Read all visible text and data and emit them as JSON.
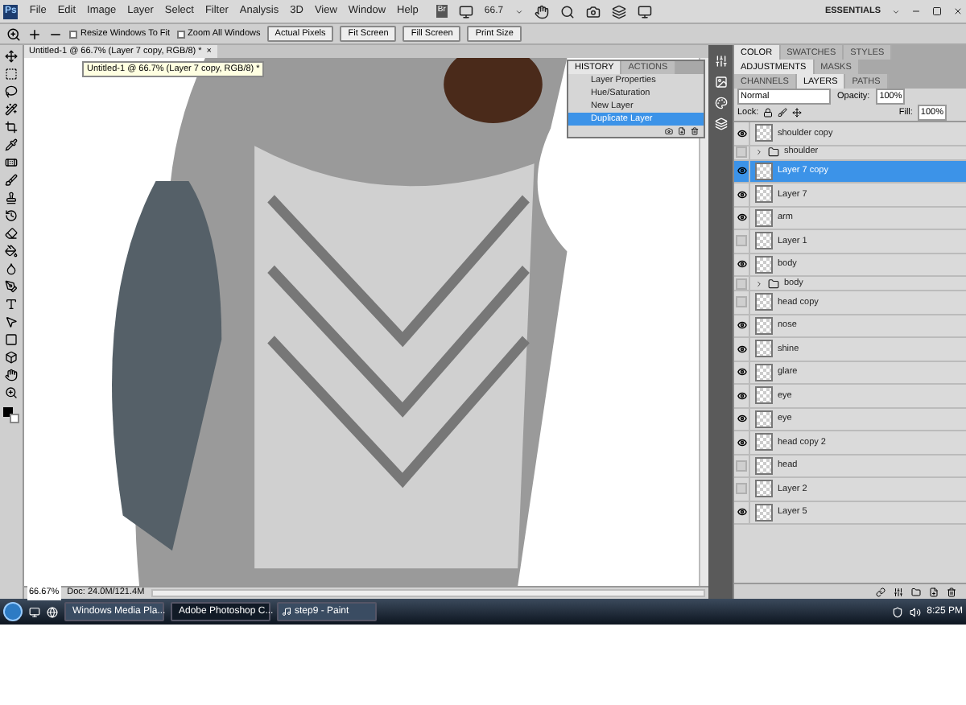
{
  "app_bar": {
    "logo": "Ps",
    "menus": [
      "File",
      "Edit",
      "Image",
      "Layer",
      "Select",
      "Filter",
      "Analysis",
      "3D",
      "View",
      "Window",
      "Help"
    ],
    "bridge": "Br",
    "zoom": "66.7",
    "workspace": "ESSENTIALS"
  },
  "options_bar": {
    "checkboxes": [
      {
        "label": "Resize Windows To Fit",
        "checked": false
      },
      {
        "label": "Zoom All Windows",
        "checked": false
      }
    ],
    "buttons": [
      "Actual Pixels",
      "Fit Screen",
      "Fill Screen",
      "Print Size"
    ]
  },
  "document": {
    "tab": "Untitled-1 @ 66.7% (Layer 7 copy, RGB/8) *",
    "close": "×",
    "tooltip": "Untitled-1 @ 66.7% (Layer 7 copy, RGB/8) *",
    "zoom": "66.67%",
    "doc_size": "Doc: 24.0M/121.4M"
  },
  "history": {
    "tabs": [
      {
        "label": "HISTORY",
        "selected": true
      },
      {
        "label": "ACTIONS",
        "selected": false
      }
    ],
    "items": [
      {
        "label": "Layer Properties",
        "selected": false
      },
      {
        "label": "Hue/Saturation",
        "selected": false
      },
      {
        "label": "New Layer",
        "selected": false
      },
      {
        "label": "Duplicate Layer",
        "selected": true
      }
    ]
  },
  "panel_groups": [
    [
      {
        "label": "COLOR",
        "selected": true
      },
      {
        "label": "SWATCHES",
        "selected": false
      },
      {
        "label": "STYLES",
        "selected": false
      }
    ],
    [
      {
        "label": "ADJUSTMENTS",
        "selected": true
      },
      {
        "label": "MASKS",
        "selected": false
      }
    ],
    [
      {
        "label": "CHANNELS",
        "selected": false
      },
      {
        "label": "LAYERS",
        "selected": true
      },
      {
        "label": "PATHS",
        "selected": false
      }
    ]
  ],
  "layers_panel": {
    "blend_mode": "Normal",
    "opacity_label": "Opacity:",
    "opacity": "100%",
    "lock_label": "Lock:",
    "fill_label": "Fill:",
    "fill": "100%",
    "layers": [
      {
        "kind": "layer",
        "name": "shoulder copy",
        "visible": true,
        "selected": false
      },
      {
        "kind": "group",
        "name": "shoulder",
        "visible": false,
        "selected": false,
        "expanded": false
      },
      {
        "kind": "layer",
        "name": "Layer 7 copy",
        "visible": true,
        "selected": true
      },
      {
        "kind": "layer",
        "name": "Layer 7",
        "visible": true,
        "selected": false
      },
      {
        "kind": "layer",
        "name": "arm",
        "visible": true,
        "selected": false
      },
      {
        "kind": "layer",
        "name": "Layer 1",
        "visible": false,
        "selected": false
      },
      {
        "kind": "layer",
        "name": "body",
        "visible": true,
        "selected": false
      },
      {
        "kind": "group",
        "name": "body",
        "visible": false,
        "selected": false,
        "expanded": false
      },
      {
        "kind": "layer",
        "name": "head copy",
        "visible": false,
        "selected": false
      },
      {
        "kind": "layer",
        "name": "nose",
        "visible": true,
        "selected": false
      },
      {
        "kind": "layer",
        "name": "shine",
        "visible": true,
        "selected": false
      },
      {
        "kind": "layer",
        "name": "glare",
        "visible": true,
        "selected": false
      },
      {
        "kind": "layer",
        "name": "eye",
        "visible": true,
        "selected": false
      },
      {
        "kind": "layer",
        "name": "eye",
        "visible": true,
        "selected": false
      },
      {
        "kind": "layer",
        "name": "head copy 2",
        "visible": true,
        "selected": false
      },
      {
        "kind": "layer",
        "name": "head",
        "visible": false,
        "selected": false
      },
      {
        "kind": "layer",
        "name": "Layer 2",
        "visible": false,
        "selected": false
      },
      {
        "kind": "layer",
        "name": "Layer 5",
        "visible": true,
        "selected": false
      }
    ]
  },
  "taskbar": {
    "tasks": [
      {
        "label": "Windows Media Pla...",
        "selected": false
      },
      {
        "label": "Adobe Photoshop C...",
        "selected": true
      },
      {
        "label": "step9 - Paint",
        "selected": false
      }
    ],
    "time": "8:25 PM"
  }
}
